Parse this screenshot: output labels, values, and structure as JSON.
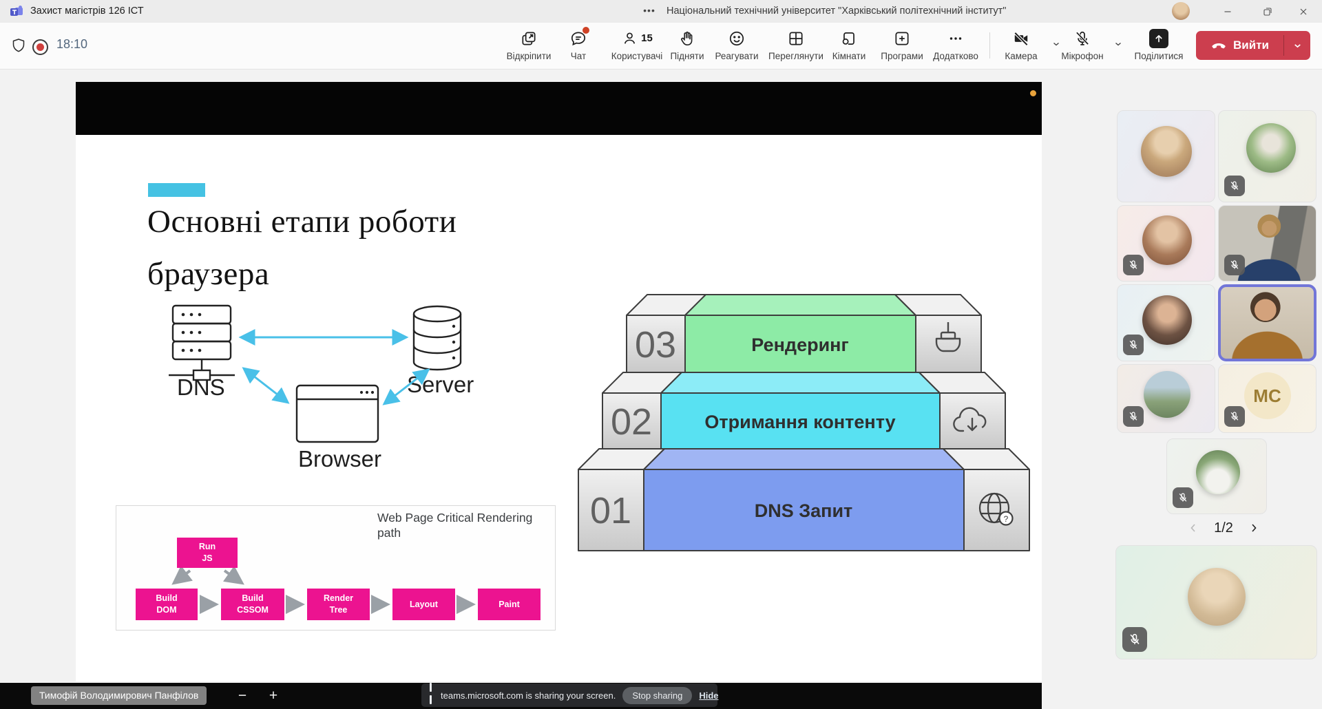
{
  "window": {
    "title": "Захист магістрів 126 ІСТ",
    "org": "Національний технічний університет \"Харківський політехнічний інститут\"",
    "overflow_dots": "•••"
  },
  "toolbar": {
    "timer": "18:10",
    "buttons": [
      {
        "id": "unpin",
        "label": "Відкріпити"
      },
      {
        "id": "chat",
        "label": "Чат"
      },
      {
        "id": "people",
        "label": "Користувачі",
        "count": "15"
      },
      {
        "id": "raise",
        "label": "Підняти"
      },
      {
        "id": "react",
        "label": "Реагувати"
      },
      {
        "id": "view",
        "label": "Переглянути"
      },
      {
        "id": "rooms",
        "label": "Кімнати"
      },
      {
        "id": "apps",
        "label": "Програми"
      },
      {
        "id": "more",
        "label": "Додатково"
      }
    ],
    "camera_label": "Камера",
    "mic_label": "Мікрофон",
    "share_label": "Поділитися",
    "leave_label": "Вийти"
  },
  "slide": {
    "title_line1": "Основні етапи роботи",
    "title_line2": "браузера",
    "network": {
      "dns": "DNS",
      "server": "Server",
      "browser": "Browser"
    },
    "crp": {
      "title_line1": "Web Page Critical Rendering",
      "title_line2": "path",
      "run": {
        "l1": "Run",
        "l2": "JS"
      },
      "dom": {
        "l1": "Build",
        "l2": "DOM"
      },
      "cssom": {
        "l1": "Build",
        "l2": "CSSOM"
      },
      "tree": {
        "l1": "Render",
        "l2": "Tree"
      },
      "layout": "Layout",
      "paint": "Paint"
    },
    "steps": [
      {
        "num": "03",
        "label": "Рендеринг"
      },
      {
        "num": "02",
        "label": "Отримання контенту"
      },
      {
        "num": "01",
        "label": "DNS Запит"
      }
    ]
  },
  "sidebar": {
    "pagination": "1/2",
    "initials_tile": "MC"
  },
  "bottom": {
    "presenter": "Тимофій Володимирович Панфілов",
    "zoom_out": "−",
    "zoom_in": "+",
    "toast": {
      "message": "teams.microsoft.com is sharing your screen.",
      "stop": "Stop sharing",
      "hide": "Hide"
    }
  },
  "colors": {
    "accent_cyan": "#45c2e3",
    "diagram_arrow": "#49c0e8",
    "crp_pink": "#ec1390",
    "step_green": "#8deba6",
    "step_cyan": "#58e1f2",
    "step_blue": "#7d9cef",
    "leave_red": "#cc3e4e",
    "record_red": "#d0403d",
    "chat_badge_red": "#cf4226",
    "active_speaker_border": "#7276d8"
  }
}
